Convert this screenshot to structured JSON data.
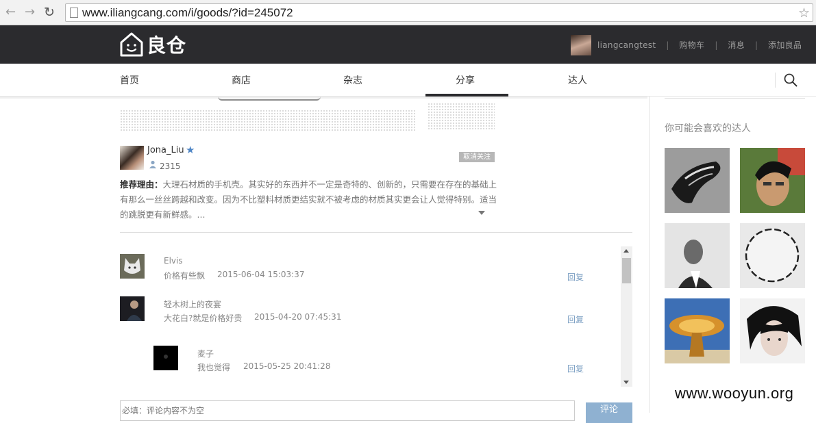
{
  "browser": {
    "url": "www.iliangcang.com/i/goods/?id=245072",
    "back_icon": "back-arrow-icon",
    "forward_icon": "forward-arrow-icon",
    "reload_icon": "reload-icon",
    "bookmark_icon": "star-icon"
  },
  "header": {
    "logo_text": "良仓",
    "username": "liangcangtest",
    "links": [
      "购物车",
      "消息",
      "添加良品"
    ],
    "background": "#2b2b2e"
  },
  "nav": {
    "items": [
      "首页",
      "商店",
      "杂志",
      "分享",
      "达人"
    ],
    "active": "分享",
    "search_icon": "search-icon"
  },
  "author": {
    "name": "Jona_Liu",
    "followers": "2315",
    "unfollow_label": "取消关注"
  },
  "reason": {
    "label": "推荐理由：",
    "text": "大理石材质的手机壳。其实好的东西并不一定是奇特的、创新的，只需要在存在的基础上有那么一丝丝跨越和改变。因为不比塑料材质更结实就不被考虑的材质其实更会让人觉得特别。适当的跳脱更有新鲜感。..."
  },
  "comments": [
    {
      "name": "Elvis",
      "text": "价格有些飘",
      "time": "2015-06-04 15:03:37",
      "reply": "回复"
    },
    {
      "name": "轻木树上的夜宴",
      "text": "大花白?就是价格好贵",
      "time": "2015-04-20 07:45:31",
      "reply": "回复"
    },
    {
      "name": "麦子",
      "text": "我也觉得",
      "time": "2015-05-25 20:41:28",
      "reply": "回复"
    }
  ],
  "comment_form": {
    "placeholder": "必填：评论内容不为空",
    "submit_label": "评论",
    "submit_color": "#8fb1d1"
  },
  "sidebar": {
    "title": "你可能会喜欢的达人"
  },
  "watermark": "www.wooyun.org"
}
